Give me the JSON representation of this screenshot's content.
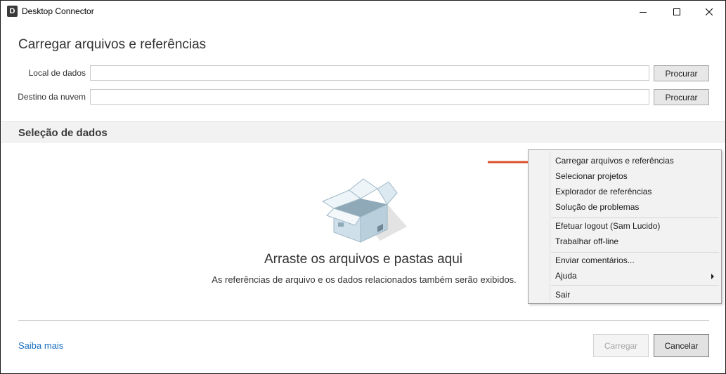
{
  "window": {
    "app_icon_letter": "D",
    "title": "Desktop Connector"
  },
  "page": {
    "title": "Carregar arquivos e referências"
  },
  "form": {
    "local_label": "Local de dados",
    "local_value": "",
    "dest_label": "Destino da nuvem",
    "dest_value": "",
    "browse_label": "Procurar"
  },
  "section": {
    "title": "Seleção de dados"
  },
  "dropzone": {
    "title": "Arraste os arquivos e pastas aqui",
    "subtitle": "As referências de arquivo e os dados relacionados também serão exibidos."
  },
  "context_menu": {
    "items": [
      "Carregar arquivos e referências",
      "Selecionar projetos",
      "Explorador de referências",
      "Solução de problemas",
      "Efetuar logout (Sam Lucido)",
      "Trabalhar off-line",
      "Enviar comentários...",
      "Ajuda",
      "Sair"
    ]
  },
  "footer": {
    "learn_more": "Saiba mais",
    "upload_label": "Carregar",
    "cancel_label": "Cancelar"
  },
  "colors": {
    "link": "#1a6fc1",
    "arrow": "#d9502a",
    "menu_bg": "#f2f2f2"
  }
}
